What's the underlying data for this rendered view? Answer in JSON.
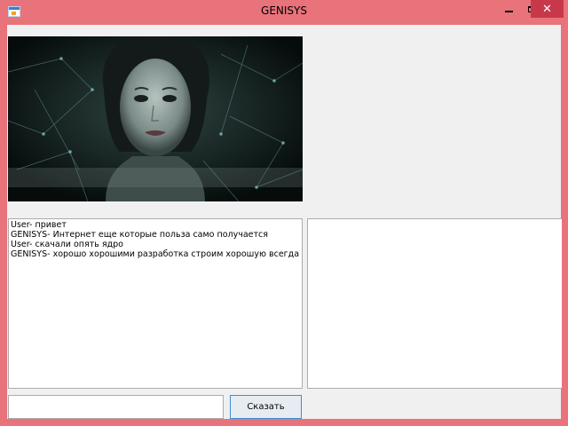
{
  "window": {
    "title": "GENISYS",
    "close_glyph": "✕"
  },
  "chat": {
    "lines": [
      "User- привет",
      "GENISYS- Интернет еще которые польза само получается",
      "User- скачали опять ядро",
      "GENISYS- хорошо хорошими разработка строим хорошую всегда"
    ]
  },
  "input": {
    "value": ""
  },
  "buttons": {
    "say_label": "Сказать"
  },
  "colors": {
    "window_frame": "#e8737b",
    "close_button": "#c7394a",
    "client_bg": "#f0f0f0",
    "button_border": "#3c8fd8"
  },
  "icons": {
    "app": "app-window-icon",
    "minimize": "minimize-icon",
    "maximize": "maximize-icon",
    "close": "close-icon"
  }
}
